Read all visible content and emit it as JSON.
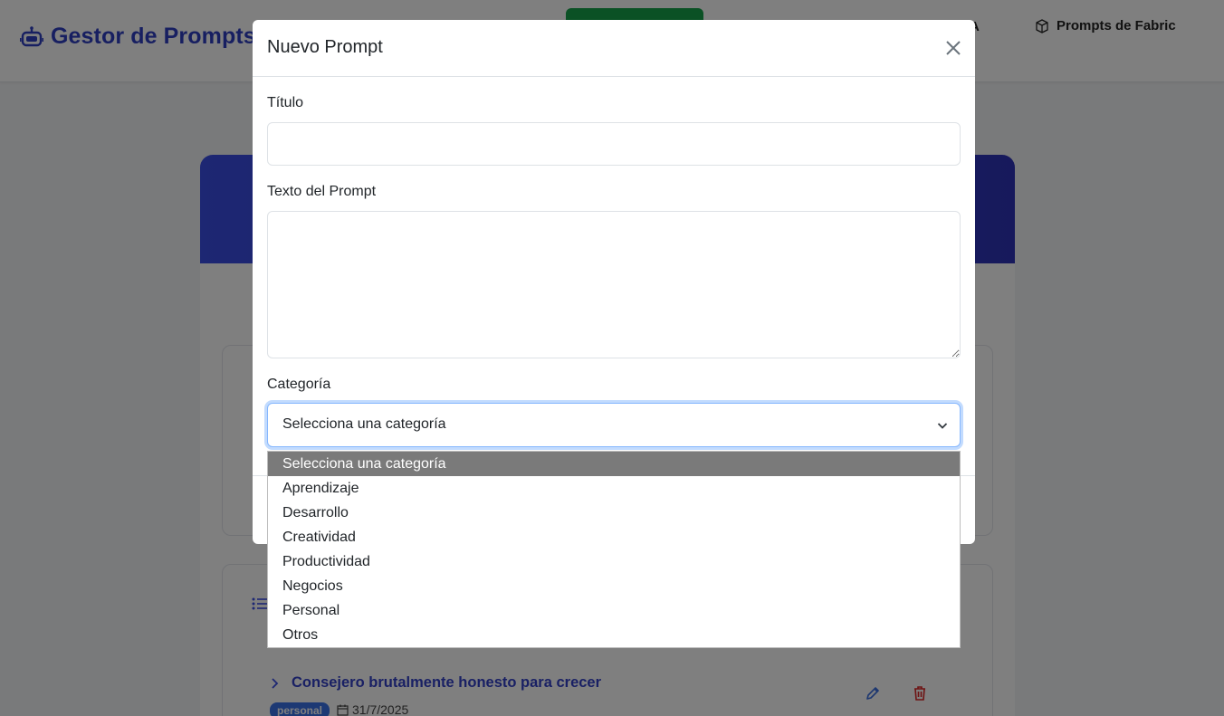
{
  "navbar": {
    "brand": "Gestor de Prompts",
    "nav_ia_suffix": "A",
    "nav_fabric": "Prompts de Fabric"
  },
  "prompt_list": {
    "item": {
      "title": "Consejero brutalmente honesto para crecer",
      "badge": "personal",
      "date": "31/7/2025"
    }
  },
  "modal": {
    "title": "Nuevo Prompt",
    "title_label": "Título",
    "title_value": "",
    "text_label": "Texto del Prompt",
    "text_value": "",
    "category_label": "Categoría",
    "category_selected": "Selecciona una categoría"
  },
  "category_dropdown": {
    "options": [
      "Selecciona una categoría",
      "Aprendizaje",
      "Desarrollo",
      "Creatividad",
      "Productividad",
      "Negocios",
      "Personal",
      "Otros"
    ],
    "highlighted": "Selecciona una categoría"
  },
  "colors": {
    "brand": "#2f3fc2",
    "hero_gradient_start": "#3b4ee6",
    "hero_gradient_end": "#2e33b8",
    "nav_green": "#16a34a",
    "delete_red": "#dc2626",
    "focus_border": "#86b7fe",
    "option_highlight": "#7a7a7a"
  },
  "icons": [
    "robot-icon",
    "cube-icon",
    "list-icon",
    "chevron-right-icon",
    "calendar-icon",
    "pencil-icon",
    "trash-icon",
    "close-icon",
    "chevron-down-icon"
  ]
}
